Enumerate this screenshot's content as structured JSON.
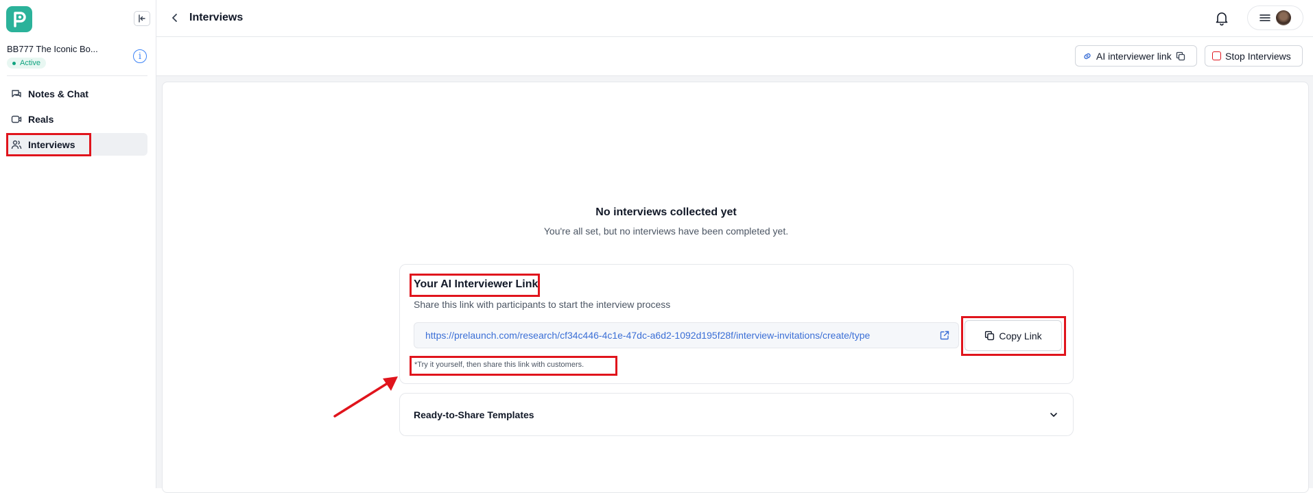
{
  "sidebar": {
    "project_name": "BB777 The Iconic Bo...",
    "status": "Active",
    "items": [
      {
        "label": "Notes & Chat",
        "icon": "chat-icon"
      },
      {
        "label": "Reals",
        "icon": "video-icon"
      },
      {
        "label": "Interviews",
        "icon": "users-icon",
        "active": true
      }
    ]
  },
  "header": {
    "title": "Interviews"
  },
  "subbar": {
    "ai_link_label": "AI interviewer link",
    "stop_label": "Stop Interviews"
  },
  "empty_state": {
    "title": "No interviews collected yet",
    "subtitle": "You're all set, but no interviews have been completed yet."
  },
  "link_card": {
    "title": "Your AI Interviewer Link",
    "description": "Share this link with participants to start the interview process",
    "url": "https://prelaunch.com/research/cf34c446-4c1e-47dc-a6d2-1092d195f28f/interview-invitations/create/type",
    "copy_label": "Copy Link",
    "hint": "*Try it yourself, then share this link with customers."
  },
  "templates": {
    "label": "Ready-to-Share Templates"
  },
  "colors": {
    "brand": "#2bb29a",
    "highlight": "#e0141c",
    "link": "#3b6fd6"
  }
}
